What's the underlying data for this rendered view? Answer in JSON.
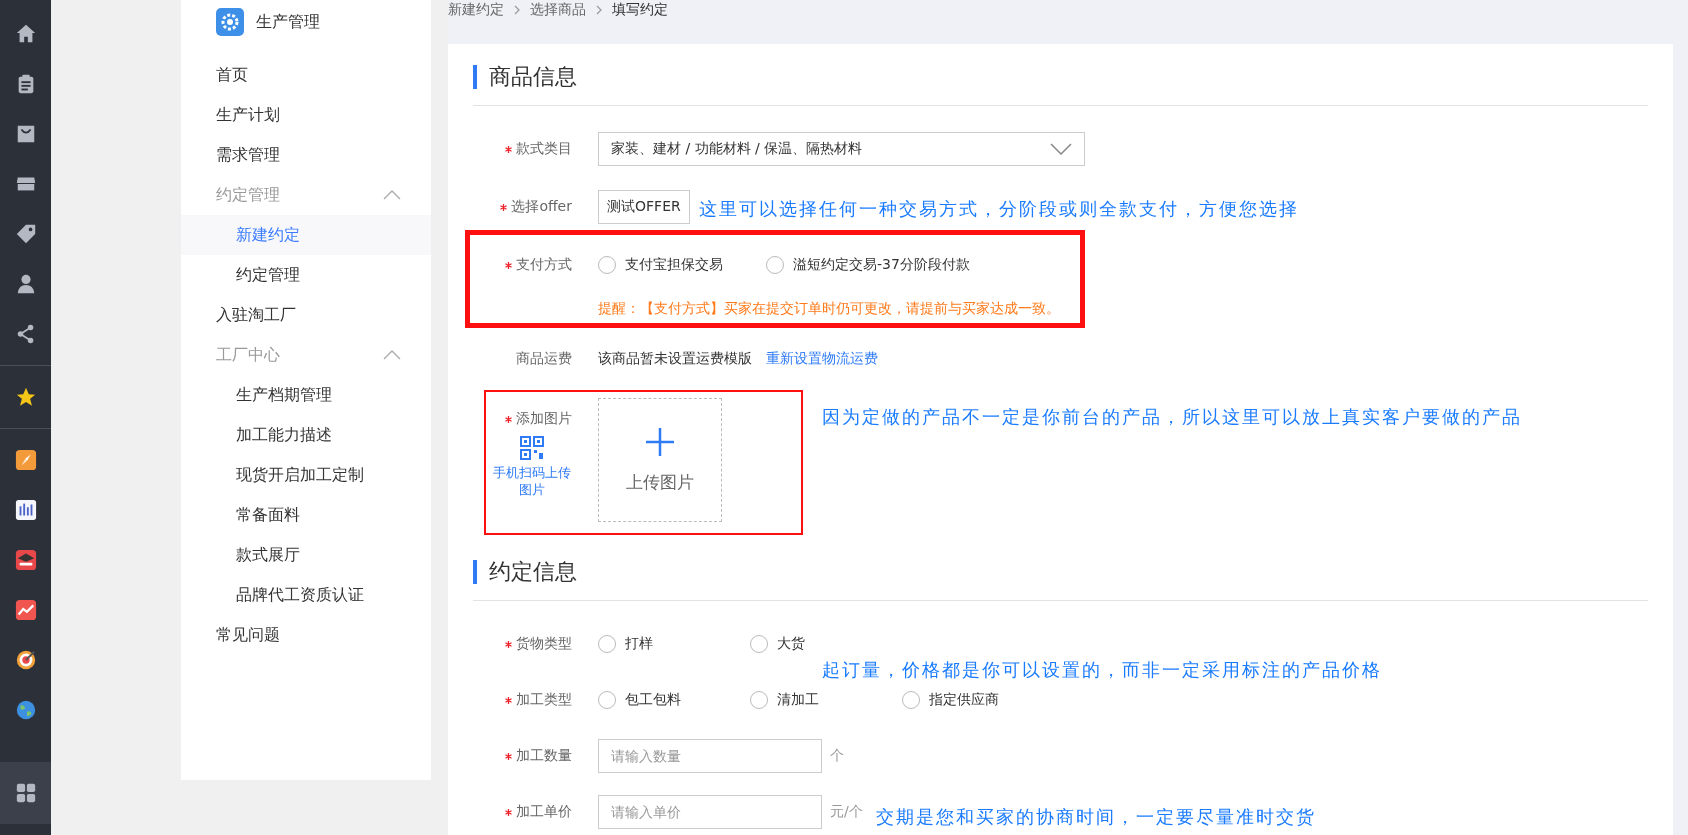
{
  "sidebar": {
    "title": "生产管理",
    "items": [
      {
        "kind": "link",
        "label": "首页"
      },
      {
        "kind": "link",
        "label": "生产计划"
      },
      {
        "kind": "link",
        "label": "需求管理"
      },
      {
        "kind": "group",
        "label": "约定管理",
        "expanded": true,
        "children": [
          {
            "label": "新建约定",
            "selected": true
          },
          {
            "label": "约定管理",
            "selected": false
          }
        ]
      },
      {
        "kind": "link",
        "label": "入驻淘工厂"
      },
      {
        "kind": "group",
        "label": "工厂中心",
        "expanded": true,
        "children": [
          {
            "label": "生产档期管理",
            "selected": false
          },
          {
            "label": "加工能力描述",
            "selected": false
          },
          {
            "label": "现货开启加工定制",
            "selected": false
          },
          {
            "label": "常备面料",
            "selected": false
          },
          {
            "label": "款式展厅",
            "selected": false
          },
          {
            "label": "品牌代工资质认证",
            "selected": false
          }
        ]
      },
      {
        "kind": "link",
        "label": "常见问题"
      }
    ]
  },
  "breadcrumb": [
    "新建约定",
    "选择商品",
    "填写约定"
  ],
  "sections": [
    {
      "title": "商品信息",
      "rows": [
        {
          "kind": "select",
          "label": "款式类目",
          "required": true,
          "value": "家装、建材 / 功能材料 / 保温、隔热材料"
        },
        {
          "kind": "select",
          "label": "选择offer",
          "required": true,
          "value": "测试OFFER"
        },
        {
          "kind": "radio",
          "label": "支付方式",
          "required": true,
          "options": [
            {
              "label": "支付宝担保交易",
              "selected": false
            },
            {
              "label": "溢短约定交易-37分阶段付款",
              "selected": false
            }
          ],
          "note": "提醒：【支付方式】买家在提交订单时仍可更改，请提前与买家达成一致。"
        },
        {
          "kind": "text",
          "label": "商品运费",
          "required": false,
          "text": "该商品暂未设置运费模版",
          "link": "重新设置物流运费"
        },
        {
          "kind": "upload",
          "label": "添加图片",
          "required": true,
          "qr_label": "手机扫码上传图片",
          "upload_label": "上传图片"
        }
      ]
    },
    {
      "title": "约定信息",
      "rows": [
        {
          "kind": "radio",
          "label": "货物类型",
          "required": true,
          "options": [
            {
              "label": "打样",
              "selected": false
            },
            {
              "label": "大货",
              "selected": false
            }
          ]
        },
        {
          "kind": "radio",
          "label": "加工类型",
          "required": true,
          "options": [
            {
              "label": "包工包料",
              "selected": false
            },
            {
              "label": "清加工",
              "selected": false
            },
            {
              "label": "指定供应商",
              "selected": false
            }
          ]
        },
        {
          "kind": "input",
          "label": "加工数量",
          "required": true,
          "placeholder": "请输入数量",
          "unit": "个"
        },
        {
          "kind": "input",
          "label": "加工单价",
          "required": true,
          "placeholder": "请输入单价",
          "unit": "元/个"
        }
      ]
    }
  ],
  "annotations": [
    "这里可以选择任何一种交易方式，分阶段或则全款支付，方便您选择",
    "因为定做的产品不一定是你前台的产品，所以这里可以放上真实客户要做的产品",
    "起订量，价格都是你可以设置的，而非一定采用标注的产品价格",
    "交期是您和买家的协商时间，一定要尽量准时交货"
  ]
}
